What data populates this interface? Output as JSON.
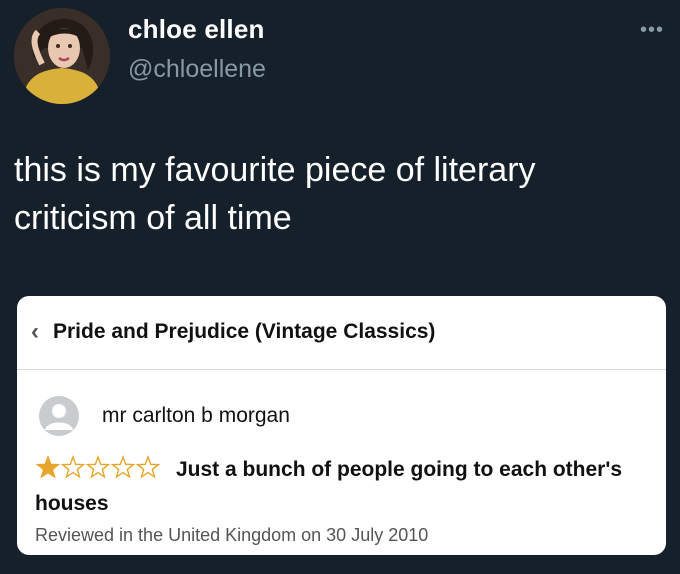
{
  "tweet": {
    "display_name": "chloe ellen",
    "handle": "@chloellene",
    "text": "this is my favourite piece of literary criticism of all time",
    "more_icon": "more-horizontal-icon"
  },
  "review_card": {
    "product_title": "Pride and Prejudice (Vintage Classics)",
    "back_icon": "chevron-left-icon",
    "reviewer_name": "mr carlton b morgan",
    "rating": 1,
    "rating_max": 5,
    "review_title": "Just a bunch of people going to each other's houses",
    "review_meta": "Reviewed in the United Kingdom on 30 July 2010",
    "colors": {
      "star": "#e7a52c",
      "text": "#111111",
      "meta": "#555555"
    }
  },
  "colors": {
    "background": "#15202b",
    "handle": "#8899a6"
  }
}
